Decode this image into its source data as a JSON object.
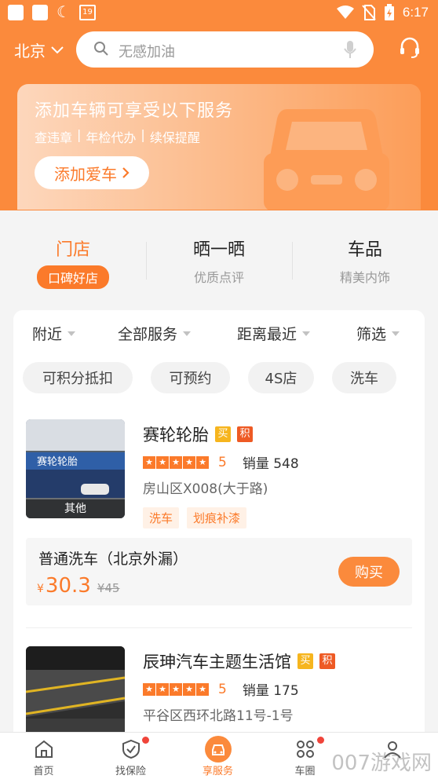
{
  "status_bar": {
    "time": "6:17",
    "calendar_day": "19"
  },
  "header": {
    "city": "北京",
    "search_placeholder": "无感加油",
    "banner": {
      "title": "添加车辆可享受以下服务",
      "services": [
        "查违章",
        "年检代办",
        "续保提醒"
      ],
      "separator": "|",
      "button_label": "添加爱车"
    }
  },
  "categories": [
    {
      "name": "门店",
      "sub": "口碑好店",
      "active": true
    },
    {
      "name": "晒一晒",
      "sub": "优质点评",
      "active": false
    },
    {
      "name": "车品",
      "sub": "精美内饰",
      "active": false
    }
  ],
  "filters": [
    "附近",
    "全部服务",
    "距离最近",
    "筛选"
  ],
  "chips": [
    "可积分抵扣",
    "可预约",
    "4S店",
    "洗车"
  ],
  "shops": [
    {
      "name": "赛轮轮胎",
      "badge_buy": "买",
      "badge_points": "积",
      "rating": 5,
      "score": "5",
      "sales_label": "销量",
      "sales": "548",
      "address": "房山区X008(大于路)",
      "image_tag": "其他",
      "storefront_sign": "赛轮轮胎",
      "tags": [
        "洗车",
        "划痕补漆"
      ]
    },
    {
      "name": "辰珅汽车主题生活馆",
      "badge_buy": "买",
      "badge_points": "积",
      "rating": 5,
      "score": "5",
      "sales_label": "销量",
      "sales": "175",
      "address": "平谷区西环北路11号-1号"
    }
  ],
  "deal": {
    "name": "普通洗车（北京外漏）",
    "currency": "¥",
    "price": "30.3",
    "original_price": "¥45",
    "button_label": "购买"
  },
  "tabbar": [
    {
      "label": "首页",
      "icon": "home-icon",
      "badge": false
    },
    {
      "label": "找保险",
      "icon": "shield-icon",
      "badge": true
    },
    {
      "label": "享服务",
      "icon": "car-service-icon",
      "badge": false,
      "active": true
    },
    {
      "label": "车圈",
      "icon": "grid-icon",
      "badge": true
    },
    {
      "label": "",
      "icon": "profile-icon",
      "badge": false
    }
  ],
  "watermark": "007游戏网",
  "colors": {
    "brand": "#fb8a3c",
    "accent": "#fb7a2a",
    "badge_buy": "#f6b51e",
    "badge_points": "#ee5a24"
  }
}
